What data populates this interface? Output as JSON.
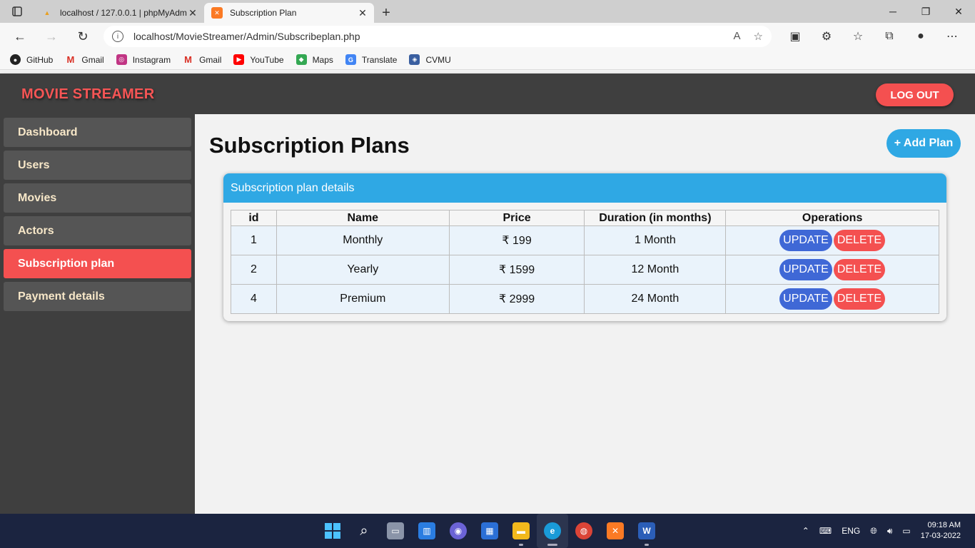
{
  "browser": {
    "tabs": [
      {
        "title": "localhost / 127.0.0.1 | phpMyAdmin",
        "active": false
      },
      {
        "title": "Subscription Plan",
        "active": true
      }
    ],
    "url": "localhost/MovieStreamer/Admin/Subscribeplan.php",
    "bookmarks": [
      {
        "label": "GitHub",
        "icon": "github-icon",
        "color": "#222222"
      },
      {
        "label": "Gmail",
        "icon": "gmail-icon",
        "color": "#d93025"
      },
      {
        "label": "Instagram",
        "icon": "instagram-icon",
        "color": "#c13584"
      },
      {
        "label": "Gmail",
        "icon": "gmail-icon",
        "color": "#d93025"
      },
      {
        "label": "YouTube",
        "icon": "youtube-icon",
        "color": "#ff0000"
      },
      {
        "label": "Maps",
        "icon": "maps-icon",
        "color": "#34a853"
      },
      {
        "label": "Translate",
        "icon": "translate-icon",
        "color": "#4285f4"
      },
      {
        "label": "CVMU",
        "icon": "cvmu-icon",
        "color": "#3a5fa0"
      }
    ]
  },
  "app": {
    "brand": "MOVIE STREAMER",
    "logout_label": "LOG OUT",
    "sidebar": [
      {
        "label": "Dashboard",
        "active": false
      },
      {
        "label": "Users",
        "active": false
      },
      {
        "label": "Movies",
        "active": false
      },
      {
        "label": "Actors",
        "active": false
      },
      {
        "label": "Subscription plan",
        "active": true
      },
      {
        "label": "Payment details",
        "active": false
      }
    ],
    "page_title": "Subscription Plans",
    "add_plan_label": "+ Add Plan",
    "card_title": "Subscription plan details",
    "table": {
      "columns": [
        "id",
        "Name",
        "Price",
        "Duration (in months)",
        "Operations"
      ],
      "rows": [
        {
          "id": "1",
          "name": "Monthly",
          "price": "₹ 199",
          "duration": "1 Month"
        },
        {
          "id": "2",
          "name": "Yearly",
          "price": "₹ 1599",
          "duration": "12 Month"
        },
        {
          "id": "4",
          "name": "Premium",
          "price": "₹ 2999",
          "duration": "24 Month"
        }
      ],
      "update_label": "UPDATE",
      "delete_label": "DELETE"
    }
  },
  "taskbar": {
    "language": "ENG",
    "time": "09:18 AM",
    "date": "17-03-2022"
  },
  "colors": {
    "accent_red": "#f45050",
    "accent_blue": "#2fa8e4",
    "update_blue": "#3f68d6",
    "header_dark": "#3f3f3f"
  }
}
